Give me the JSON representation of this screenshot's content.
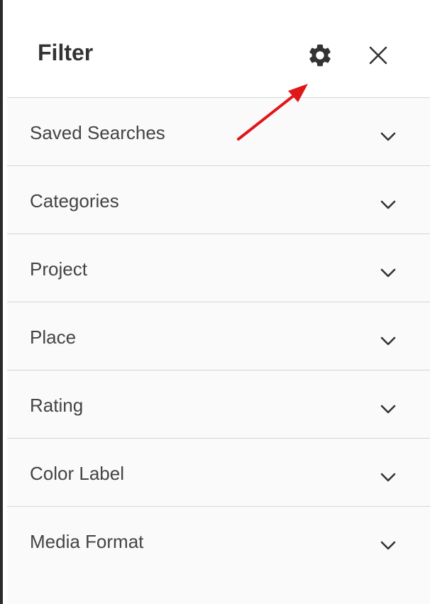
{
  "filter_panel": {
    "title": "Filter",
    "sections": [
      {
        "label": "Saved Searches"
      },
      {
        "label": "Categories"
      },
      {
        "label": "Project"
      },
      {
        "label": "Place"
      },
      {
        "label": "Rating"
      },
      {
        "label": "Color Label"
      },
      {
        "label": "Media Format"
      }
    ]
  },
  "icons": {
    "settings": "gear-icon",
    "close": "close-icon",
    "expand": "chevron-down-icon",
    "annotation": "red-arrow-icon"
  },
  "colors": {
    "title_text": "#333333",
    "label_text": "#444444",
    "divider": "#d6d6d6",
    "panel_bg": "#fafafa",
    "annotation_arrow": "#e0161b"
  }
}
